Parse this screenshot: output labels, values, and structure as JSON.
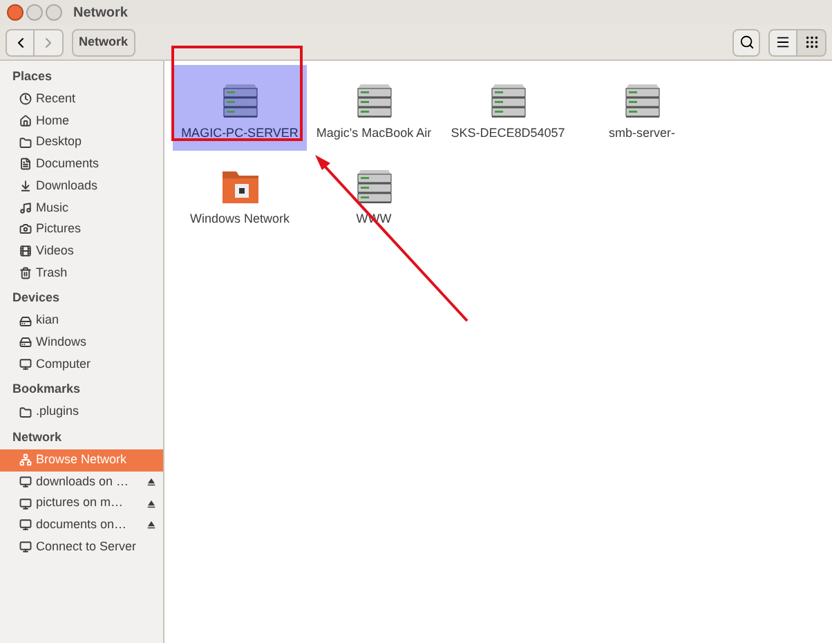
{
  "window": {
    "title": "Network"
  },
  "toolbar": {
    "path": "Network"
  },
  "sidebar": [
    {
      "heading": "Places",
      "items": [
        {
          "label": "Recent",
          "selected": false
        },
        {
          "label": "Home",
          "selected": false
        },
        {
          "label": "Desktop",
          "selected": false
        },
        {
          "label": "Documents",
          "selected": false
        },
        {
          "label": "Downloads",
          "selected": false
        },
        {
          "label": "Music",
          "selected": false
        },
        {
          "label": "Pictures",
          "selected": false
        },
        {
          "label": "Videos",
          "selected": false
        },
        {
          "label": "Trash",
          "selected": false
        }
      ]
    },
    {
      "heading": "Devices",
      "items": [
        {
          "label": "kian",
          "selected": false
        },
        {
          "label": "Windows",
          "selected": false
        },
        {
          "label": "Computer",
          "selected": false
        }
      ]
    },
    {
      "heading": "Bookmarks",
      "items": [
        {
          "label": ".plugins",
          "selected": false
        }
      ]
    },
    {
      "heading": "Network",
      "items": [
        {
          "label": "Browse Network",
          "selected": true,
          "ejectable": false
        },
        {
          "label": "downloads on …",
          "selected": false,
          "ejectable": true
        },
        {
          "label": "pictures on m…",
          "selected": false,
          "ejectable": true
        },
        {
          "label": "documents on…",
          "selected": false,
          "ejectable": true
        },
        {
          "label": "Connect to Server",
          "selected": false,
          "ejectable": false
        }
      ]
    }
  ],
  "items": [
    {
      "label": "MAGIC-PC-SERVER",
      "kind": "server",
      "selected": true
    },
    {
      "label": "Magic's MacBook Air",
      "kind": "server",
      "selected": false
    },
    {
      "label": "SKS-DECE8D54057",
      "kind": "server",
      "selected": false
    },
    {
      "label": "smb-server-",
      "kind": "server",
      "selected": false
    },
    {
      "label": "Windows Network",
      "kind": "folder",
      "selected": false
    },
    {
      "label": "WWW",
      "kind": "server",
      "selected": false
    }
  ]
}
